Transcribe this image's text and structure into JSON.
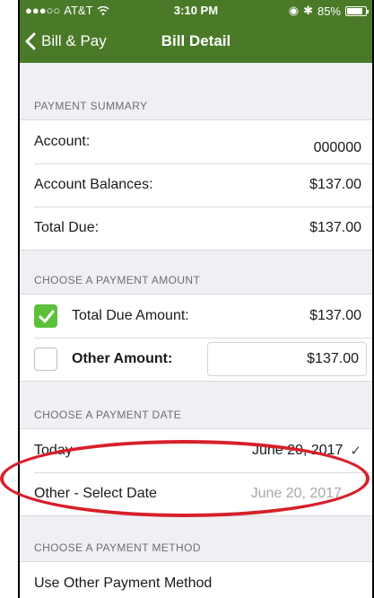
{
  "status_bar": {
    "carrier": "AT&T",
    "time": "3:10 PM",
    "battery": "85%",
    "battery_level": 0.85
  },
  "nav": {
    "back_label": "Bill & Pay",
    "title": "Bill Detail"
  },
  "payment_summary": {
    "header": "PAYMENT SUMMARY",
    "rows": [
      {
        "label": "Account:",
        "value": "000000"
      },
      {
        "label": "Account Balances:",
        "value": "$137.00"
      },
      {
        "label": "Total Due:",
        "value": "$137.00"
      }
    ]
  },
  "payment_amount": {
    "header": "CHOOSE A PAYMENT AMOUNT",
    "total_due": {
      "label": "Total Due Amount:",
      "value": "$137.00",
      "checked": true
    },
    "other": {
      "label": "Other Amount:",
      "value": "$137.00",
      "checked": false
    }
  },
  "payment_date": {
    "header": "CHOOSE A PAYMENT DATE",
    "today": {
      "label": "Today",
      "value": "June 20, 2017"
    },
    "other": {
      "label": "Other - Select Date",
      "value": "June 20, 2017"
    }
  },
  "payment_method": {
    "header": "CHOOSE A PAYMENT METHOD",
    "other": {
      "label": "Use Other Payment Method"
    }
  },
  "colors": {
    "nav_green": "#4a7a28",
    "check_green": "#5cc13a",
    "highlight_red": "#d7202a"
  }
}
